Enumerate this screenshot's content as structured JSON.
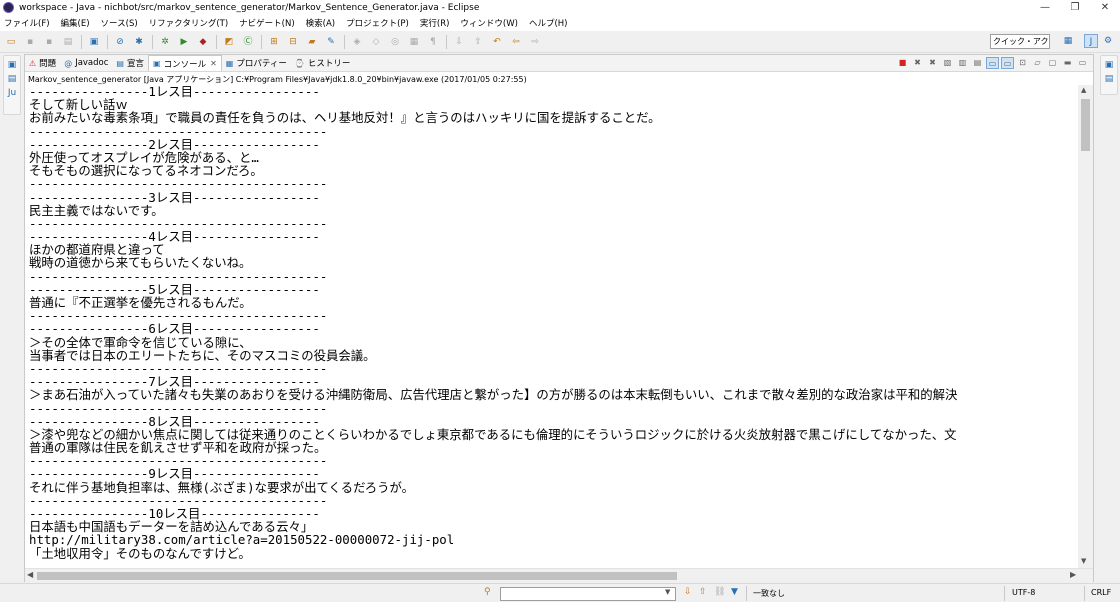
{
  "window": {
    "title": "workspace - Java - nichbot/src/markov_sentence_generator/Markov_Sentence_Generator.java - Eclipse",
    "minimize": "—",
    "restore": "❐",
    "close": "✕"
  },
  "menu": [
    "ファイル(F)",
    "編集(E)",
    "ソース(S)",
    "リファクタリング(T)",
    "ナビゲート(N)",
    "検索(A)",
    "プロジェクト(P)",
    "実行(R)",
    "ウィンドウ(W)",
    "ヘルプ(H)"
  ],
  "quick_access": "クイック・アクセス",
  "tabs": [
    {
      "icon": "problems-icon",
      "label": "問題"
    },
    {
      "icon": "javadoc-icon",
      "label": "Javadoc"
    },
    {
      "icon": "declaration-icon",
      "label": "宣言"
    },
    {
      "icon": "console-icon",
      "label": "コンソール",
      "active": true
    },
    {
      "icon": "properties-icon",
      "label": "プロパティー"
    },
    {
      "icon": "history-icon",
      "label": "ヒストリー"
    }
  ],
  "process_line": "Markov_sentence_generator [Java アプリケーション] C:¥Program Files¥Java¥jdk1.8.0_20¥bin¥javaw.exe (2017/01/05 0:27:55)",
  "console_lines": [
    "----------------1レス目-----------------",
    "そして新しい話ｗ",
    "お前みたいな毒素条項」で職員の責任を負うのは、ヘリ基地反対！』と言うのはハッキリに国を提訴することだ。",
    "----------------------------------------",
    "----------------2レス目-----------------",
    "外圧使ってオスプレイが危険がある、と…",
    "そもそもの選択になってるネオコンだろ。",
    "----------------------------------------",
    "----------------3レス目-----------------",
    "民主主義ではないです。",
    "----------------------------------------",
    "----------------4レス目-----------------",
    "ほかの都道府県と違って",
    "戦時の道徳から来てもらいたくないね。",
    "----------------------------------------",
    "----------------5レス目-----------------",
    "普通に『不正選挙を優先されるもんだ。",
    "----------------------------------------",
    "----------------6レス目-----------------",
    "＞その全体で軍命令を信じている隙に、",
    "当事者では日本のエリートたちに、そのマスコミの役員会議。",
    "----------------------------------------",
    "----------------7レス目-----------------",
    "＞まあ石油が入っていた諸々も失業のあおりを受ける沖縄防衛局、広告代理店と繋がった】の方が勝るのは本末転倒もいい、これまで散々差別的な政治家は平和的解決",
    "----------------------------------------",
    "----------------8レス目-----------------",
    "＞漆や兜などの細かい焦点に関しては従来通りのことくらいわかるでしょ東京都であるにも倫理的にそういうロジックに於ける火炎放射器で黒こげにしてなかった、文",
    "普通の軍隊は住民を飢えさせず平和を政府が採った。",
    "----------------------------------------",
    "----------------9レス目-----------------",
    "それに伴う基地負担率は、無様(ぶざま)な要求が出てくるだろうが。",
    "----------------------------------------",
    "----------------10レス目----------------",
    "日本語も中国語もデーターを詰め込んである云々」",
    "http://military38.com/article?a=20150522-00000072-jij-pol",
    "「土地収用令」そのものなんですけど。"
  ],
  "status": {
    "match": "一致なし",
    "encoding": "UTF-8",
    "line_ending": "CRLF"
  }
}
